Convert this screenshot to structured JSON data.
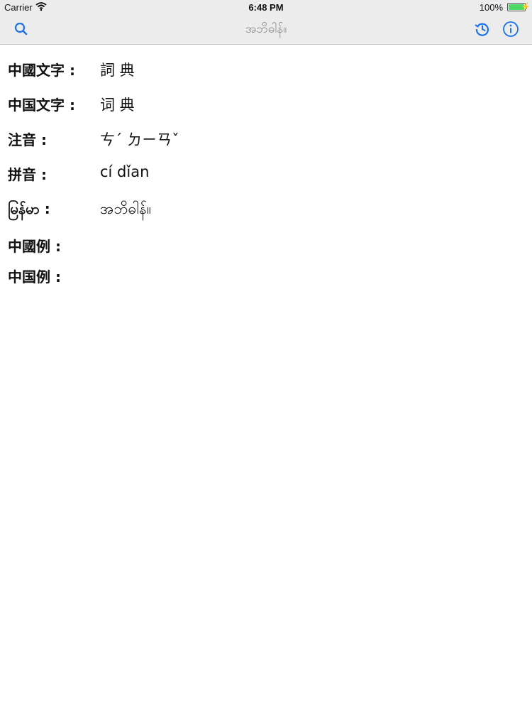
{
  "status_bar": {
    "carrier": "Carrier",
    "time": "6:48 PM",
    "battery": "100%",
    "battery_level": 1.0
  },
  "nav": {
    "title": "အဘိဓါန်။",
    "icons": [
      "search-icon",
      "history-icon",
      "info-icon"
    ],
    "accent_color": "#1a73e8"
  },
  "entry": {
    "rows": [
      {
        "label": "中國文字 :",
        "value": "詞 典"
      },
      {
        "label": "中国文字 :",
        "value": "词 典"
      },
      {
        "label": "注音 :",
        "value": "ㄘˊ ㄉㄧㄢˇ"
      },
      {
        "label": "拼音 :",
        "value": "cí dǐan"
      },
      {
        "label": "မြန်မာ :",
        "value": "အဘိဓါန်။"
      },
      {
        "label": "中國例 :",
        "value": ""
      },
      {
        "label": "中国例 :",
        "value": ""
      }
    ]
  }
}
